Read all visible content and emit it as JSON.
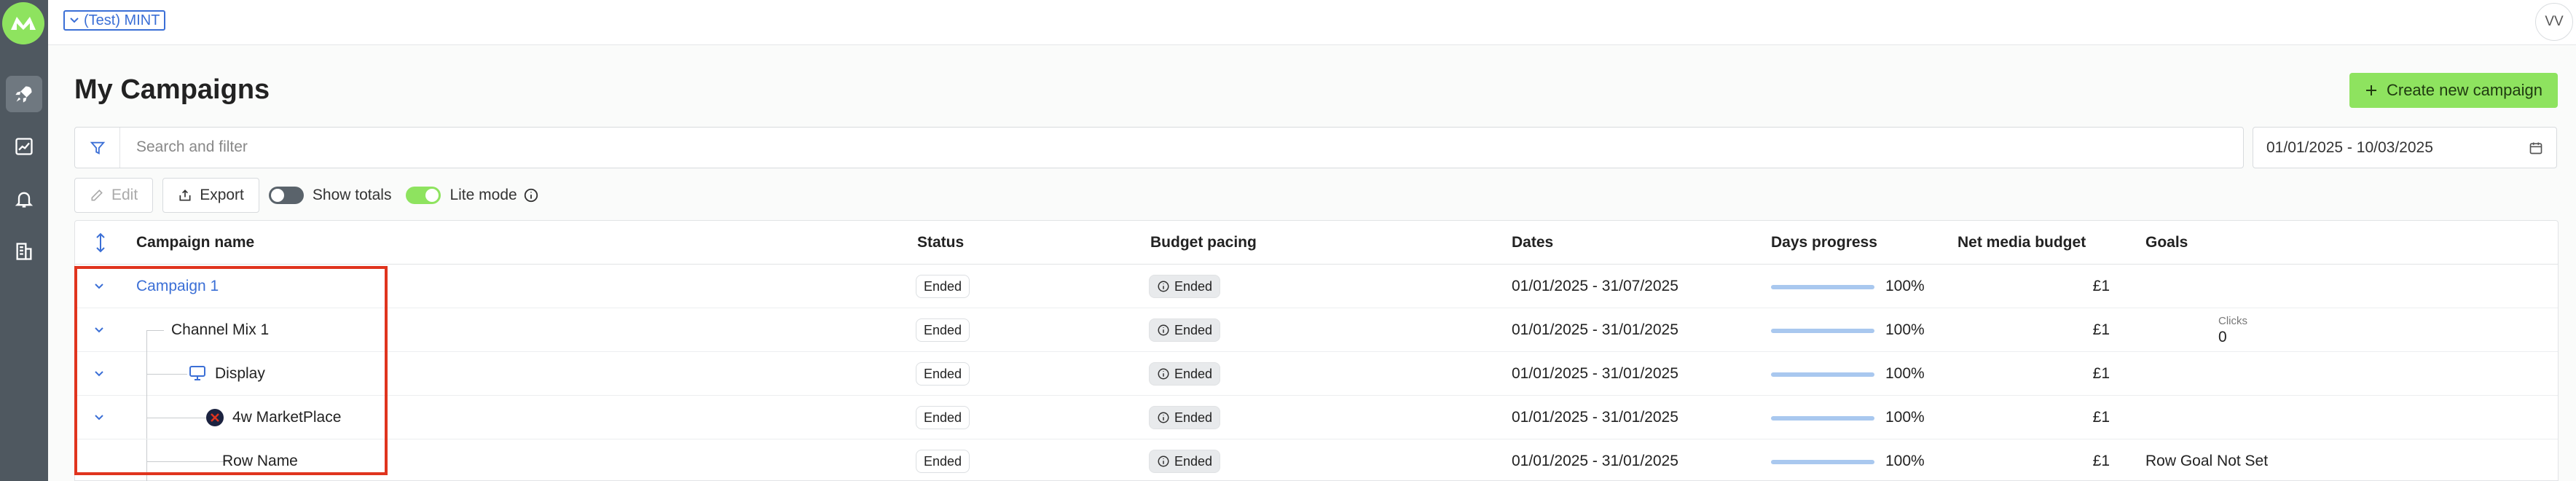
{
  "header": {
    "account_label": "(Test) MINT",
    "avatar_initials": "VV"
  },
  "sidebar": {
    "items": [
      {
        "name": "campaigns",
        "icon": "rocket-icon",
        "active": true
      },
      {
        "name": "reports",
        "icon": "chart-icon",
        "active": false
      },
      {
        "name": "notifications",
        "icon": "bell-icon",
        "active": false
      },
      {
        "name": "organisation",
        "icon": "building-icon",
        "active": false
      }
    ]
  },
  "page": {
    "title": "My Campaigns",
    "create_label": "Create new campaign"
  },
  "search": {
    "placeholder": "Search and filter"
  },
  "date_range": {
    "value": "01/01/2025 - 10/03/2025"
  },
  "toolbar": {
    "edit_label": "Edit",
    "export_label": "Export",
    "show_totals_label": "Show totals",
    "show_totals_on": false,
    "lite_mode_label": "Lite mode",
    "lite_mode_on": true
  },
  "table": {
    "columns": [
      "Campaign name",
      "Status",
      "Budget pacing",
      "Dates",
      "Days progress",
      "Net media budget",
      "Goals"
    ],
    "rows": [
      {
        "name": "Campaign 1",
        "status": "Ended",
        "pacing": "Ended",
        "dates": "01/01/2025 - 31/07/2025",
        "progress": "100%",
        "budget": "£1",
        "goal_label": "",
        "goal_value": ""
      },
      {
        "name": "Channel Mix 1",
        "status": "Ended",
        "pacing": "Ended",
        "dates": "01/01/2025 - 31/01/2025",
        "progress": "100%",
        "budget": "£1",
        "goal_label": "Clicks",
        "goal_value": "0"
      },
      {
        "name": "Display",
        "status": "Ended",
        "pacing": "Ended",
        "dates": "01/01/2025 - 31/01/2025",
        "progress": "100%",
        "budget": "£1",
        "goal_label": "",
        "goal_value": ""
      },
      {
        "name": "4w MarketPlace",
        "status": "Ended",
        "pacing": "Ended",
        "dates": "01/01/2025 - 31/01/2025",
        "progress": "100%",
        "budget": "£1",
        "goal_label": "",
        "goal_value": ""
      },
      {
        "name": "Row Name",
        "status": "Ended",
        "pacing": "Ended",
        "dates": "01/01/2025 - 31/01/2025",
        "progress": "100%",
        "budget": "£1",
        "goal_label": "",
        "goal_value": "Row Goal Not Set"
      }
    ]
  },
  "colors": {
    "accent_green": "#8ee35f",
    "link_blue": "#3b6fd6",
    "highlight_red": "#e0341e"
  }
}
